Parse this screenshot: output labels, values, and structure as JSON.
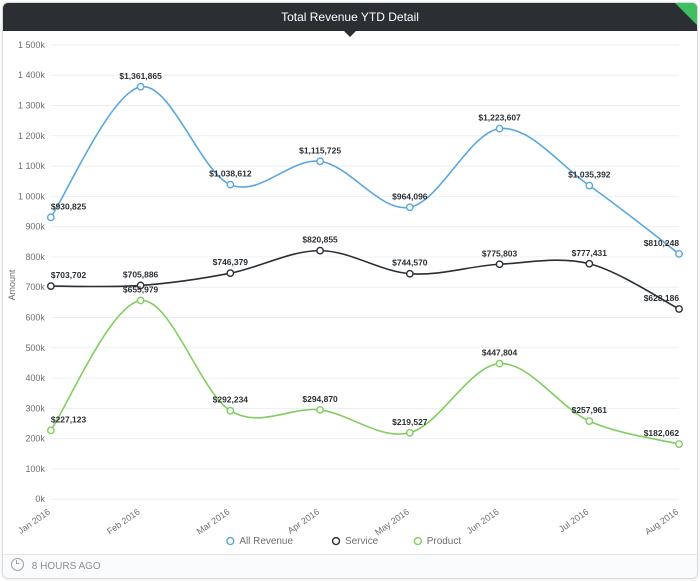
{
  "header": {
    "title": "Total Revenue YTD Detail"
  },
  "footer": {
    "age": "8 HOURS AGO"
  },
  "axes": {
    "ylabel": "Amount"
  },
  "colors": {
    "all": "#5ba7dc",
    "service": "#2b2f33",
    "product": "#7fce5f"
  },
  "legend": {
    "all": "All Revenue",
    "service": "Service",
    "product": "Product"
  },
  "chart_data": {
    "type": "line",
    "categories": [
      "Jan 2016",
      "Feb 2016",
      "Mar 2016",
      "Apr 2016",
      "May 2016",
      "Jun 2016",
      "Jul 2016",
      "Aug 2016"
    ],
    "ylim": [
      0,
      1500000
    ],
    "ytick_step": 100000,
    "series": [
      {
        "name": "All Revenue",
        "color_key": "all",
        "values": [
          930825,
          1361865,
          1038612,
          1115725,
          964096,
          1223607,
          1035392,
          810248
        ],
        "labels": [
          "$930,825",
          "$1,361,865",
          "$1,038,612",
          "$1,115,725",
          "$964,096",
          "$1,223,607",
          "$1,035,392",
          "$810,248"
        ]
      },
      {
        "name": "Service",
        "color_key": "service",
        "values": [
          703702,
          705886,
          746379,
          820855,
          744570,
          775803,
          777431,
          628186
        ],
        "labels": [
          "$703,702",
          "$705,886",
          "$746,379",
          "$820,855",
          "$744,570",
          "$775,803",
          "$777,431",
          "$628,186"
        ]
      },
      {
        "name": "Product",
        "color_key": "product",
        "values": [
          227123,
          655979,
          292234,
          294870,
          219527,
          447804,
          257961,
          182062
        ],
        "labels": [
          "$227,123",
          "$655,979",
          "$292,234",
          "$294,870",
          "$219,527",
          "$447,804",
          "$257,961",
          "$182,062"
        ]
      }
    ]
  }
}
